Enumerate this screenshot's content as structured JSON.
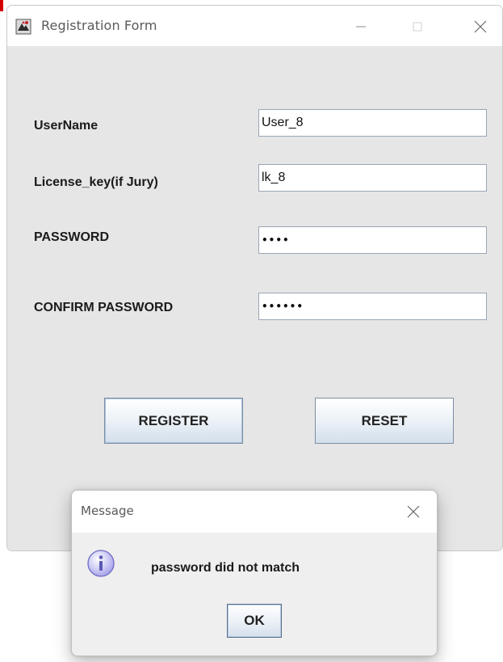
{
  "window": {
    "title": "Registration Form",
    "controls": {
      "minimize_icon": "minimize-icon",
      "maximize_icon": "maximize-icon",
      "close_icon": "close-icon"
    }
  },
  "form": {
    "fields": [
      {
        "label": "UserName",
        "value": "User_8"
      },
      {
        "label": "License_key(if Jury)",
        "value": "lk_8"
      },
      {
        "label": "PASSWORD",
        "value": "••••"
      },
      {
        "label": "CONFIRM PASSWORD",
        "value": "••••••"
      }
    ],
    "buttons": {
      "register": "REGISTER",
      "reset": "RESET"
    }
  },
  "dialog": {
    "title": "Message",
    "icon": "info-icon",
    "message": "password did not match",
    "ok_label": "OK"
  },
  "colors": {
    "window_bg": "#e6e6e6",
    "titlebar_bg": "#ffffff",
    "button_border": "#7d8ea3",
    "info_icon": "#b9b7f0"
  }
}
